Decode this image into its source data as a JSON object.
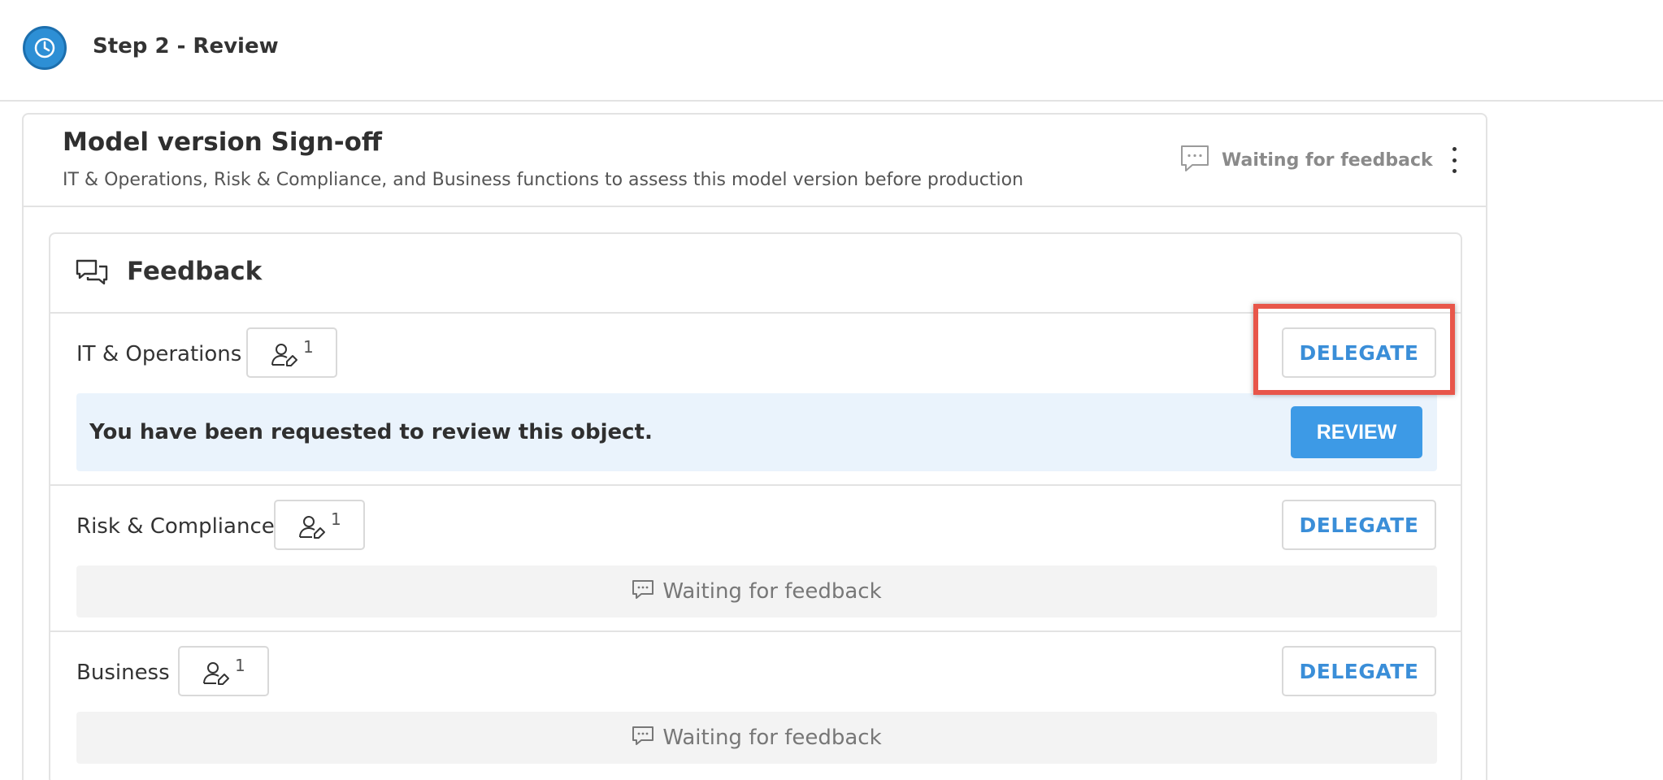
{
  "header": {
    "step_title": "Step 2 - Review",
    "icon": "clock-icon"
  },
  "card": {
    "title": "Model version Sign-off",
    "subtitle": "IT & Operations, Risk & Compliance, and Business functions to assess this model version before production",
    "status": "Waiting for feedback",
    "menu_icon": "kebab-menu-icon"
  },
  "feedback": {
    "title": "Feedback",
    "sections": [
      {
        "label": "IT & Operations",
        "reviewer_count": "1",
        "delegate_label": "DELEGATE",
        "request_text": "You have been requested to review this object.",
        "review_label": "REVIEW"
      },
      {
        "label": "Risk & Compliance",
        "reviewer_count": "1",
        "delegate_label": "DELEGATE",
        "waiting_text": "Waiting for feedback"
      },
      {
        "label": "Business",
        "reviewer_count": "1",
        "delegate_label": "DELEGATE",
        "waiting_text": "Waiting for feedback"
      }
    ]
  },
  "colors": {
    "accent": "#3a8ed8",
    "review_button": "#3d9ae6",
    "request_background": "#eaf3fc",
    "waiting_background": "#f3f3f3",
    "highlight": "#e8564a"
  }
}
